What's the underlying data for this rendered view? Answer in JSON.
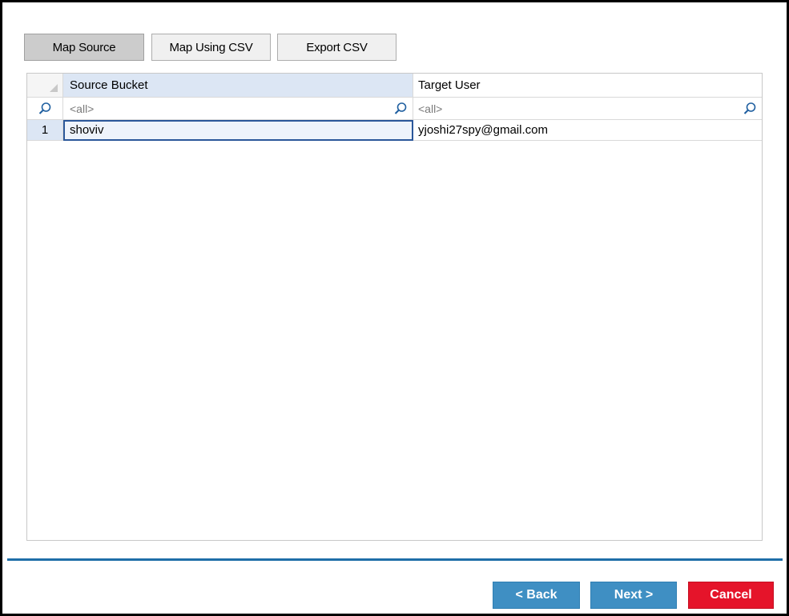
{
  "toolbar": {
    "map_source": "Map Source",
    "map_using_csv": "Map Using CSV",
    "export_csv": "Export CSV"
  },
  "grid": {
    "columns": [
      "Source Bucket",
      "Target User"
    ],
    "filter_placeholder": "<all>",
    "rows": [
      {
        "index": "1",
        "source": "shoviv",
        "target": "yjoshi27spy@gmail.com"
      }
    ]
  },
  "nav": {
    "back": "< Back",
    "next": "Next >",
    "cancel": "Cancel"
  },
  "colors": {
    "nav_blue": "#3f8fc3",
    "cancel_red": "#e5142a",
    "divider": "#1f6ea8",
    "selection_blue": "#2b579a"
  }
}
